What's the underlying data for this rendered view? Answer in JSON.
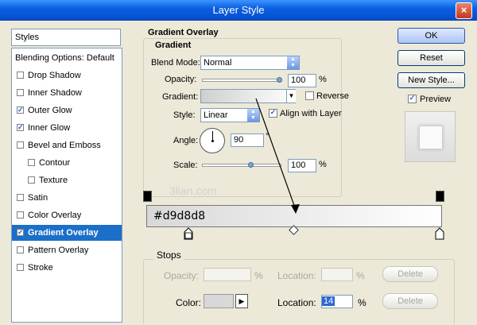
{
  "window": {
    "title": "Layer Style",
    "close_glyph": "×"
  },
  "sidebar": {
    "header": "Styles",
    "items": [
      {
        "label": "Blending Options: Default",
        "checkbox": false,
        "checked": false,
        "selected": false
      },
      {
        "label": "Drop Shadow",
        "checkbox": true,
        "checked": false,
        "selected": false
      },
      {
        "label": "Inner Shadow",
        "checkbox": true,
        "checked": false,
        "selected": false
      },
      {
        "label": "Outer Glow",
        "checkbox": true,
        "checked": true,
        "selected": false
      },
      {
        "label": "Inner Glow",
        "checkbox": true,
        "checked": true,
        "selected": false
      },
      {
        "label": "Bevel and Emboss",
        "checkbox": true,
        "checked": false,
        "selected": false
      },
      {
        "label": "Contour",
        "checkbox": true,
        "checked": false,
        "selected": false,
        "indent": true
      },
      {
        "label": "Texture",
        "checkbox": true,
        "checked": false,
        "selected": false,
        "indent": true
      },
      {
        "label": "Satin",
        "checkbox": true,
        "checked": false,
        "selected": false
      },
      {
        "label": "Color Overlay",
        "checkbox": true,
        "checked": false,
        "selected": false
      },
      {
        "label": "Gradient Overlay",
        "checkbox": true,
        "checked": true,
        "selected": true
      },
      {
        "label": "Pattern Overlay",
        "checkbox": true,
        "checked": false,
        "selected": false
      },
      {
        "label": "Stroke",
        "checkbox": true,
        "checked": false,
        "selected": false
      }
    ]
  },
  "panel": {
    "title": "Gradient Overlay",
    "group_title": "Gradient",
    "blend_mode": {
      "label": "Blend Mode:",
      "value": "Normal"
    },
    "opacity": {
      "label": "Opacity:",
      "value": "100",
      "unit": "%"
    },
    "gradient": {
      "label": "Gradient:",
      "reverse_label": "Reverse",
      "reverse_checked": false
    },
    "style": {
      "label": "Style:",
      "value": "Linear",
      "align_label": "Align with Layer",
      "align_checked": true
    },
    "angle": {
      "label": "Angle:",
      "value": "90",
      "unit": "°"
    },
    "scale": {
      "label": "Scale:",
      "value": "100",
      "unit": "%"
    }
  },
  "buttons": {
    "ok": "OK",
    "reset": "Reset",
    "new_style": "New Style...",
    "preview_label": "Preview",
    "preview_checked": true
  },
  "gradient_editor": {
    "watermark": "3lian.com",
    "color_text": "#d9d8d8",
    "stops_title": "Stops",
    "opacity_label": "Opacity:",
    "opacity_unit": "%",
    "location_label": "Location:",
    "location_unit": "%",
    "delete_label": "Delete",
    "color_label": "Color:",
    "color_location_label": "Location:",
    "color_location_value": "14",
    "color_location_unit": "%",
    "color_delete_label": "Delete"
  },
  "colors": {
    "selection": "#1c6fc9",
    "gradient_start": "#d9d8d8",
    "gradient_end": "#ffffff"
  }
}
